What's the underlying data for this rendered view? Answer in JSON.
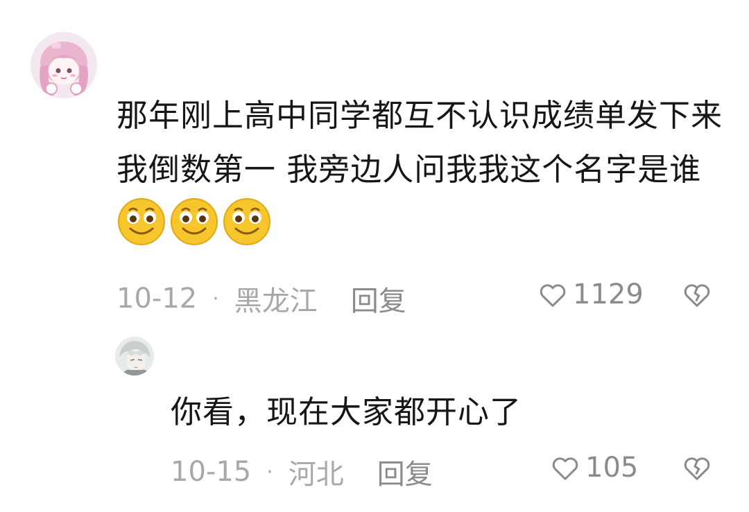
{
  "comment": {
    "avatar_icon": "anime-girl-avatar-icon",
    "text": "那年刚上高中同学都互不认识成绩单发下来我倒数第一 我旁边人问我我这个名字是谁",
    "emoji_icon": "grin-emoji-icon",
    "date": "10-12",
    "separator": "·",
    "location": "黑龙江",
    "reply_label": "回复",
    "like_count": "1129"
  },
  "reply": {
    "avatar_icon": "anime-boy-avatar-icon",
    "text": "你看，现在大家都开心了",
    "date": "10-15",
    "separator": "·",
    "location": "河北",
    "reply_label": "回复",
    "like_count": "105"
  },
  "colors": {
    "text": "#161616",
    "meta": "#a8a8a8",
    "action": "#8b8b8b",
    "emoji_face": "#f7c52c"
  }
}
